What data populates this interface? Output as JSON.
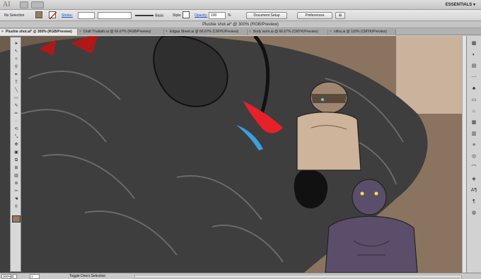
{
  "app": {
    "logo": "AI",
    "workspace": "ESSENTIALS",
    "workspace_arrow": "▾"
  },
  "control_bar": {
    "selection": "No Selection",
    "stroke_label": "Stroke:",
    "brush_label": "Basic",
    "style_label": "Style:",
    "opacity_label": "Opacity:",
    "opacity_value": "100",
    "opacity_unit": "%",
    "document_setup": "Document Setup",
    "preferences": "Preferences"
  },
  "document": {
    "title": "Plushie shot.ai* @ 300% (RGB/Preview)"
  },
  "tabs": [
    {
      "label": "Plushie shot.ai* @ 300% (RGB/Preview)",
      "close": "×",
      "active": true
    },
    {
      "label": "Draft Thaitails.ai @ 66.67% (RGB/Preview)",
      "close": "×",
      "active": false
    },
    {
      "label": "Edgaa Sheet.ai @ 66.67% (CMYK/Preview)",
      "close": "×",
      "active": false
    },
    {
      "label": "Body work.ai @ 66.67% (CMYK/Preview)",
      "close": "×",
      "active": false
    },
    {
      "label": "nitha.ai @ 118% (CMYK/Preview)",
      "close": "×",
      "active": false
    }
  ],
  "tools": [
    "➤",
    "↖",
    "✧",
    "⚲",
    "✒",
    "T",
    "╲",
    "▭",
    "✎",
    "✏",
    "◌",
    "⟲",
    "⤡",
    "✥",
    "▣",
    "⧉",
    "⊞",
    "▥",
    "⊚",
    "✂",
    "☚",
    "⚲"
  ],
  "right_panel": [
    "▦",
    "◐",
    "▤",
    "⋯",
    "♣",
    "▭",
    "⌂",
    "▦",
    "▥",
    "≡",
    "◎",
    "⌒",
    "◈",
    "A¶",
    "¶",
    "◍"
  ],
  "status_bar": {
    "zoom": "300%",
    "page": "1",
    "status_text": "Toggle Direct Selection"
  },
  "colors": {
    "canvas_bg": "#8c7561",
    "fur_dark": "#3d3d3d",
    "accent_red": "#e8202a",
    "accent_blue": "#3aa0e0"
  }
}
